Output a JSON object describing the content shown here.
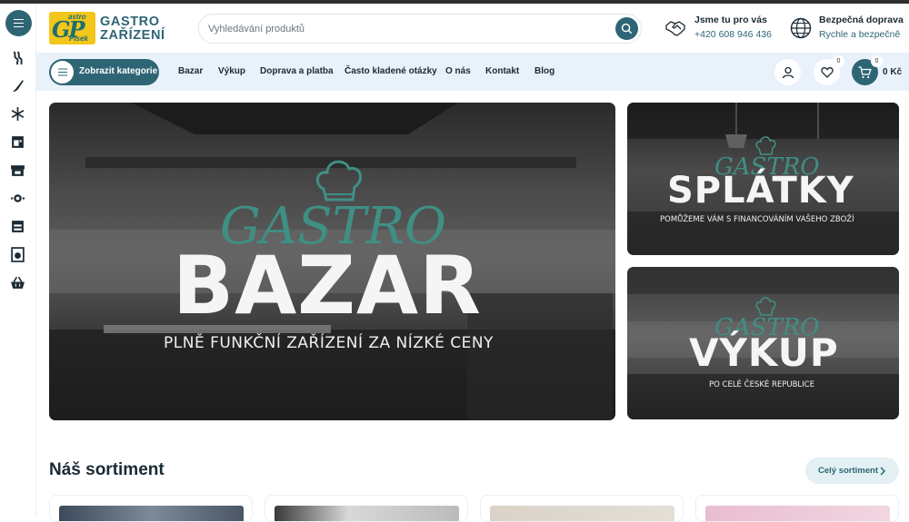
{
  "header": {
    "logo": {
      "small_top": "astro",
      "small_bottom": "Písek",
      "line1": "GASTRO",
      "line2": "ZAŘÍZENÍ"
    },
    "search_placeholder": "Vyhledávání produktů",
    "contact": {
      "title": "Jsme tu pro vás",
      "phone": "+420 608 946 436",
      "icon": "handshake-icon"
    },
    "delivery": {
      "title": "Bezpečná doprava",
      "subtitle": "Rychle a bezpečně",
      "icon": "globe-icon"
    }
  },
  "sidebar": {
    "icons": [
      "menu-icon",
      "grill-icon",
      "knife-icon",
      "snowflake-icon",
      "oven-icon",
      "stove-icon",
      "dishwasher-icon",
      "cabinet-icon",
      "washing-machine-icon",
      "basket-icon"
    ]
  },
  "nav": {
    "categories_label": "Zobrazit kategorie",
    "links": [
      "Bazar",
      "Výkup",
      "Doprava a platba",
      "Často kladené otázky",
      "O nás",
      "Kontakt",
      "Blog"
    ],
    "wishlist_count": "0",
    "cart_count": "0",
    "cart_total": "0 Kč"
  },
  "banners": {
    "main": {
      "script": "GASTRO",
      "title": "BAZAR",
      "subtitle": "PLNĚ FUNKČNÍ ZAŘÍZENÍ ZA NÍZKÉ CENY"
    },
    "top": {
      "script": "GASTRO",
      "title": "SPLÁTKY",
      "subtitle": "POMŮŽEME VÁM S FINANCOVÁNÍM VAŠEHO ZBOŽÍ"
    },
    "bottom": {
      "script": "GASTRO",
      "title": "VÝKUP",
      "subtitle": "PO CELÉ ČESKÉ REPUBLICE"
    }
  },
  "assortment": {
    "title": "Náš sortiment",
    "all_label": "Celý sortiment"
  },
  "colors": {
    "accent": "#2e6575",
    "nav_bg": "#e9f1fb",
    "script_green": "#3f8f84"
  }
}
